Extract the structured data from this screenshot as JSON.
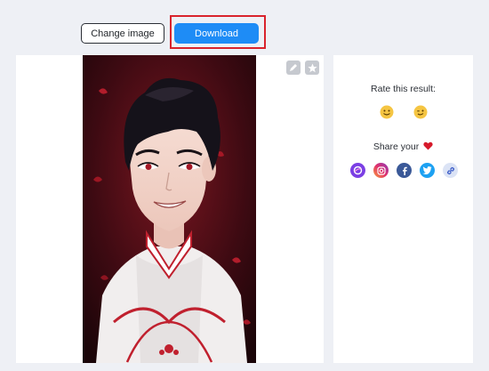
{
  "toolbar": {
    "change_label": "Change image",
    "download_label": "Download",
    "highlight_color": "#d9232d"
  },
  "image_card": {
    "tools": [
      "edit-icon",
      "star-icon"
    ]
  },
  "side_panel": {
    "rate_title": "Rate this result:",
    "rating_options": [
      "smile-emoji-icon",
      "wink-emoji-icon"
    ],
    "share_title": "Share your",
    "share_icon": "heart-icon",
    "social": [
      {
        "name": "portfolio-icon",
        "color": "#7b3fe4"
      },
      {
        "name": "instagram-icon",
        "color": "#e1306c"
      },
      {
        "name": "facebook-icon",
        "color": "#3b5998"
      },
      {
        "name": "twitter-icon",
        "color": "#1da1f2"
      },
      {
        "name": "link-icon",
        "color": "#dbe3f5"
      }
    ]
  },
  "colors": {
    "accent": "#1e8cf6",
    "background": "#eef0f5"
  }
}
